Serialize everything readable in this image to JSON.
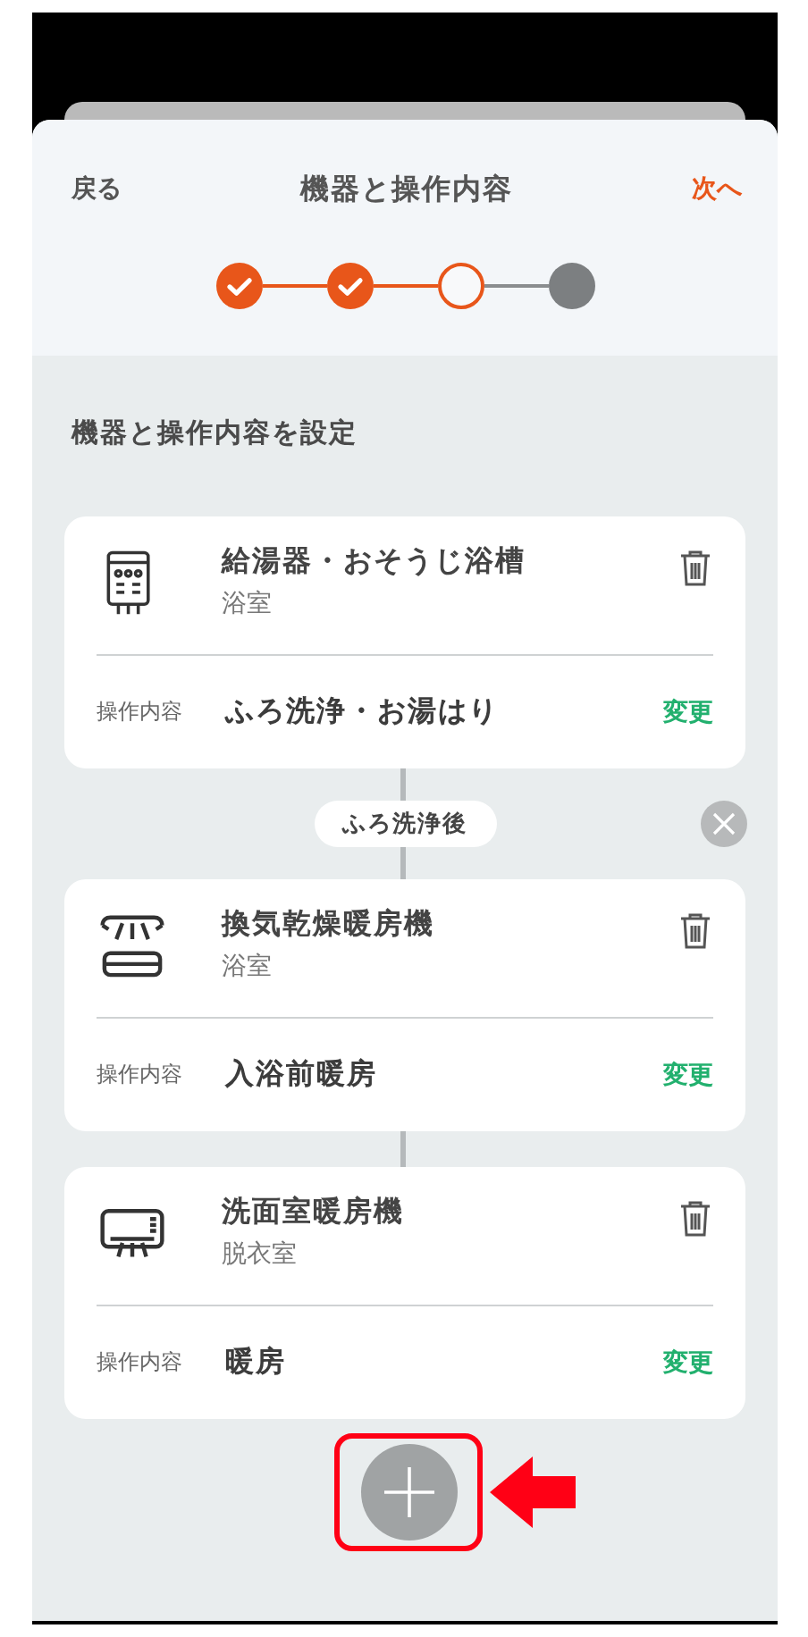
{
  "header": {
    "back": "戻る",
    "title": "機器と操作内容",
    "next": "次へ"
  },
  "steps": [
    {
      "completed": true,
      "current": false
    },
    {
      "completed": true,
      "current": false
    },
    {
      "completed": false,
      "current": true
    },
    {
      "completed": false,
      "current": false
    }
  ],
  "section_title": "機器と操作内容を設定",
  "devices": [
    {
      "kind": "water-heater",
      "name": "給湯器・おそうじ浴槽",
      "room": "浴室",
      "operation_label": "操作内容",
      "operation": "ふろ洗浄・お湯はり",
      "change": "変更",
      "condition": "ふろ洗浄後"
    },
    {
      "kind": "bath-dryer",
      "name": "換気乾燥暖房機",
      "room": "浴室",
      "operation_label": "操作内容",
      "operation": "入浴前暖房",
      "change": "変更"
    },
    {
      "kind": "wall-heater",
      "name": "洗面室暖房機",
      "room": "脱衣室",
      "operation_label": "操作内容",
      "operation": "暖房",
      "change": "変更"
    }
  ],
  "add_button": {
    "highlighted": true
  }
}
